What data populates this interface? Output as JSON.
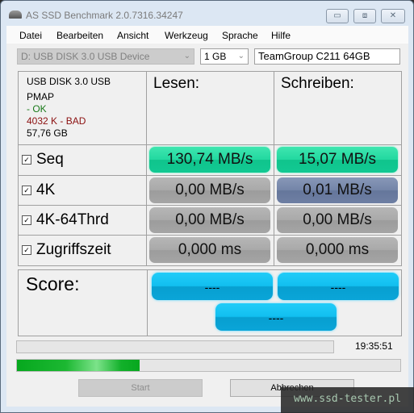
{
  "window": {
    "title": "AS SSD Benchmark 2.0.7316.34247",
    "controls": {
      "minimize": "▭",
      "maximize": "⧈",
      "close": "✕"
    }
  },
  "menu": [
    "Datei",
    "Bearbeiten",
    "Ansicht",
    "Werkzeug",
    "Sprache",
    "Hilfe"
  ],
  "toolbar": {
    "drive_select": "D: USB DISK 3.0 USB Device",
    "size_select": "1 GB",
    "drive_name": "TeamGroup C211 64GB"
  },
  "device_info": {
    "name": "USB DISK 3.0 USB",
    "driver": "PMAP",
    "driver_status": " - OK",
    "alignment": "4032 K - BAD",
    "capacity": "57,76 GB",
    "ok_color": "#1a7a1a",
    "bad_color": "#8b1010"
  },
  "headers": {
    "read": "Lesen:",
    "write": "Schreiben:"
  },
  "rows": [
    {
      "label": "Seq",
      "checked": true,
      "read": "130,74 MB/s",
      "write": "15,07 MB/s"
    },
    {
      "label": "4K",
      "checked": true,
      "read": "0,00 MB/s",
      "write": "0,01 MB/s"
    },
    {
      "label": "4K-64Thrd",
      "checked": true,
      "read": "0,00 MB/s",
      "write": "0,00 MB/s"
    },
    {
      "label": "Zugriffszeit",
      "checked": true,
      "read": "0,000 ms",
      "write": "0,000 ms"
    }
  ],
  "score": {
    "label": "Score:",
    "read": "----",
    "write": "----",
    "total": "----"
  },
  "status": {
    "elapsed": "19:35:51",
    "progress_top_percent": 0,
    "progress_bottom_percent": 32
  },
  "buttons": {
    "start": "Start",
    "cancel": "Abbrechen"
  },
  "watermark": "www.ssd-tester.pl"
}
